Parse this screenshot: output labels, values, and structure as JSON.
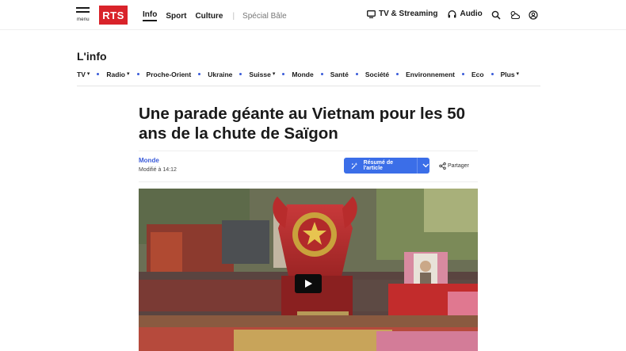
{
  "header": {
    "menu_label": "menu",
    "logo_text": "RTS",
    "nav": [
      {
        "label": "Info",
        "active": true
      },
      {
        "label": "Sport",
        "active": false
      },
      {
        "label": "Culture",
        "active": false
      }
    ],
    "special_label": "Spécial Bâle",
    "tv_label": "TV & Streaming",
    "audio_label": "Audio",
    "icons": [
      "search-icon",
      "weather-icon",
      "account-icon"
    ]
  },
  "section": {
    "title": "L'info",
    "subnav": [
      "TV",
      "Radio",
      "Proche-Orient",
      "Ukraine",
      "Suisse",
      "Monde",
      "Santé",
      "Société",
      "Environnement",
      "Eco",
      "Plus"
    ]
  },
  "article": {
    "headline": "Une parade géante au Vietnam pour les 50 ans de la chute de Saïgon",
    "rubric": "Monde",
    "modified": "Modifié à 14:12",
    "summary_label": "Résumé de l'article",
    "share_label": "Partager"
  },
  "colors": {
    "brand_red": "#d9232a",
    "accent_blue": "#3b6ee8",
    "link_blue": "#3a5bd9"
  }
}
